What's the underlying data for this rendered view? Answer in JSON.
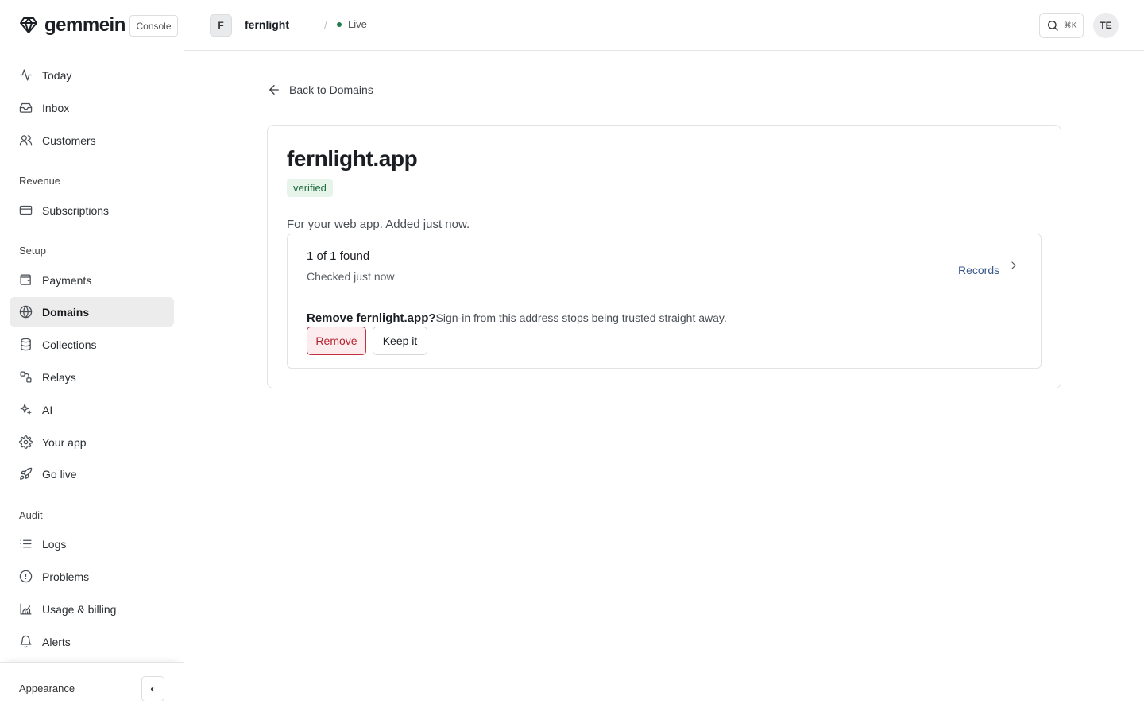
{
  "brand": {
    "name": "gemmein",
    "badge": "Console"
  },
  "sidebar": {
    "items": [
      {
        "label": "Today",
        "icon": "activity-icon"
      },
      {
        "label": "Inbox",
        "icon": "inbox-icon"
      },
      {
        "label": "Customers",
        "icon": "users-icon"
      },
      {
        "label": "Subscriptions",
        "icon": "credit-card-icon"
      },
      {
        "label": "Payments",
        "icon": "wallet-icon"
      },
      {
        "label": "Domains",
        "icon": "globe-icon",
        "active": true
      },
      {
        "label": "Collections",
        "icon": "database-icon"
      },
      {
        "label": "Relays",
        "icon": "route-icon"
      },
      {
        "label": "AI",
        "icon": "sparkles-icon"
      },
      {
        "label": "Your app",
        "icon": "gear-icon"
      },
      {
        "label": "Go live",
        "icon": "rocket-icon"
      },
      {
        "label": "Logs",
        "icon": "list-icon"
      },
      {
        "label": "Problems",
        "icon": "alert-circle-icon"
      },
      {
        "label": "Usage & billing",
        "icon": "chart-icon"
      },
      {
        "label": "Alerts",
        "icon": "bell-icon"
      }
    ],
    "sections": {
      "revenue": "Revenue",
      "setup": "Setup",
      "audit": "Audit"
    },
    "footer": {
      "appearance": "Appearance",
      "toggle": "◐"
    }
  },
  "topbar": {
    "project_initial": "F",
    "project_name": "fernlight",
    "separator": "/",
    "env": "Live",
    "env_color": "#1f7a4d",
    "shortcut": "⌘K",
    "user_initials": "TE"
  },
  "main": {
    "back_label": "Back to Domains",
    "domain": "fernlight.app",
    "status": "verified",
    "description": "For your web app. Added just now.",
    "check": {
      "found": "1 of 1 found",
      "checked": "Checked just now",
      "records_label": "Records"
    },
    "remove": {
      "question": "Remove fernlight.app?",
      "explanation": "Sign-in from this address stops being trusted straight away.",
      "remove_label": "Remove",
      "keep_label": "Keep it"
    }
  },
  "colors": {
    "danger": "#b4232f",
    "success_bg": "#e6f4ea",
    "success_text": "#1e6b3f",
    "link": "#3a5a8c"
  }
}
